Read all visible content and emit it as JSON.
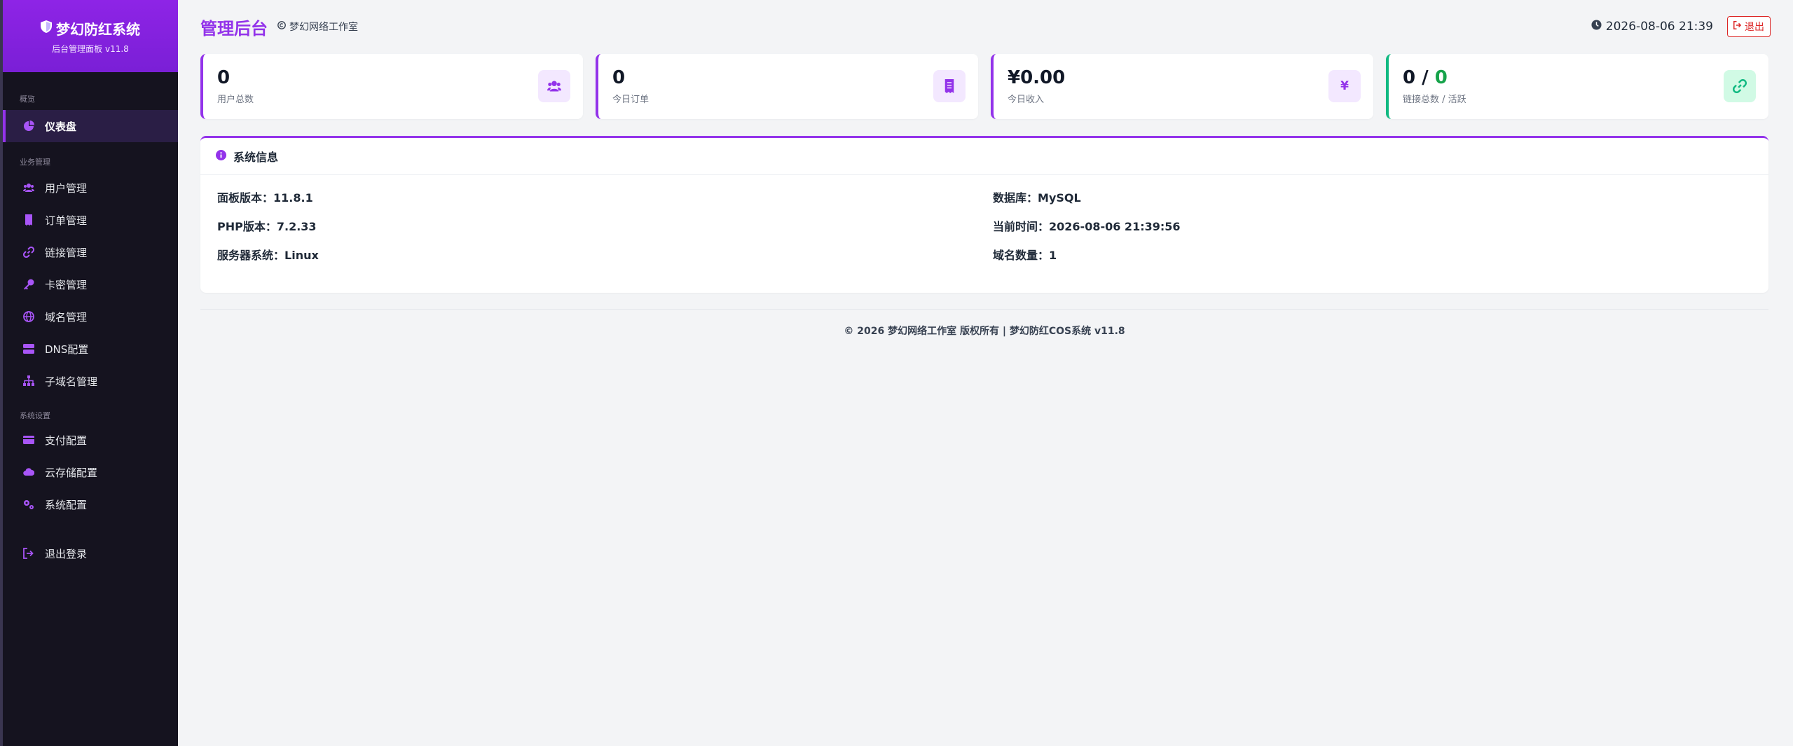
{
  "brand": {
    "title": "梦幻防红系统",
    "subtitle": "后台管理面板 v11.8"
  },
  "sidebar": {
    "groups": [
      {
        "label": "概览",
        "items": [
          {
            "label": "仪表盘",
            "icon": "dashboard-icon",
            "active": true
          }
        ]
      },
      {
        "label": "业务管理",
        "items": [
          {
            "label": "用户管理",
            "icon": "users-icon"
          },
          {
            "label": "订单管理",
            "icon": "receipt-icon"
          },
          {
            "label": "链接管理",
            "icon": "link-icon"
          },
          {
            "label": "卡密管理",
            "icon": "key-icon"
          },
          {
            "label": "域名管理",
            "icon": "globe-icon"
          },
          {
            "label": "DNS配置",
            "icon": "server-icon"
          },
          {
            "label": "子域名管理",
            "icon": "sitemap-icon"
          }
        ]
      },
      {
        "label": "系统设置",
        "items": [
          {
            "label": "支付配置",
            "icon": "credit-card-icon"
          },
          {
            "label": "云存储配置",
            "icon": "cloud-icon"
          },
          {
            "label": "系统配置",
            "icon": "gears-icon"
          }
        ]
      }
    ],
    "logout": {
      "label": "退出登录",
      "icon": "sign-out-icon"
    }
  },
  "header": {
    "title": "管理后台",
    "studio": "梦幻网络工作室",
    "datetime": "2026-08-06 21:39",
    "logout_label": "退出"
  },
  "stats": [
    {
      "value": "0",
      "label": "用户总数",
      "icon": "users-icon"
    },
    {
      "value": "0",
      "label": "今日订单",
      "icon": "receipt-icon"
    },
    {
      "value": "¥0.00",
      "label": "今日收入",
      "icon": "yen-icon",
      "glyph": "¥"
    },
    {
      "value_total": "0",
      "value_sep": " / ",
      "value_active": "0",
      "label": "链接总数 / 活跃",
      "icon": "link-icon"
    }
  ],
  "system_info": {
    "title": "系统信息",
    "rows": [
      {
        "label": "面板版本：",
        "value": "11.8.1"
      },
      {
        "label": "数据库：",
        "value": "MySQL"
      },
      {
        "label": "PHP版本：",
        "value": "7.2.33"
      },
      {
        "label": "当前时间：",
        "value": "2026-08-06 21:39:56"
      },
      {
        "label": "服务器系统：",
        "value": "Linux"
      },
      {
        "label": "域名数量：",
        "value": "1"
      }
    ]
  },
  "footer": {
    "text": "© 2026 梦幻网络工作室 版权所有 | 梦幻防红COS系统 v11.8"
  },
  "colors": {
    "accent": "#9333ea",
    "sidebar_bg": "#15131f",
    "success": "#10b981",
    "danger": "#dc2626"
  }
}
